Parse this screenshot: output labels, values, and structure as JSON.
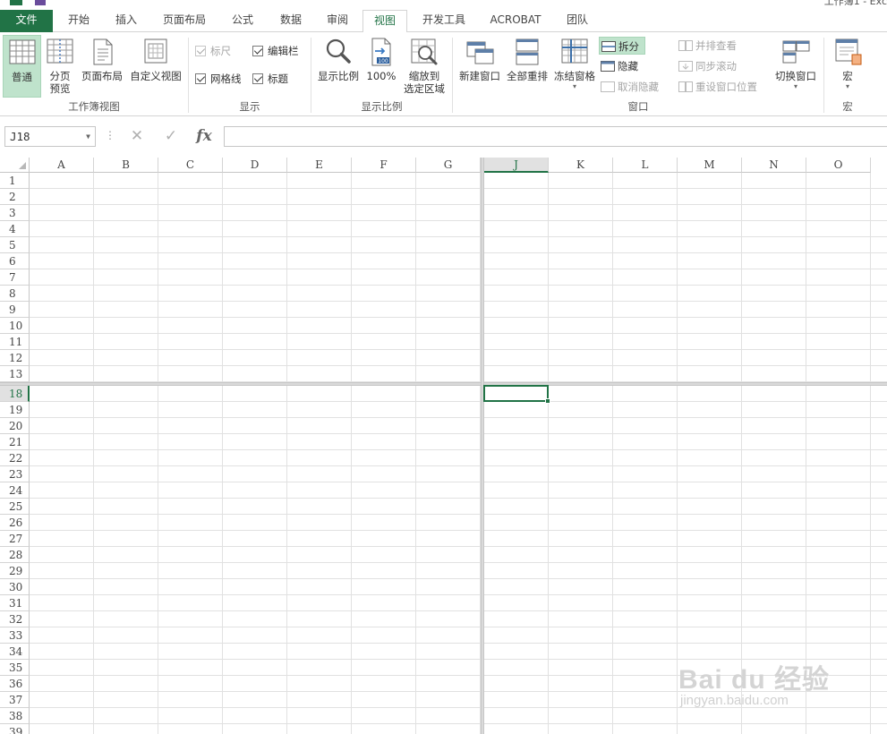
{
  "window": {
    "title_fragment": "工作簿1 - Exc"
  },
  "tabs": [
    {
      "label": "文件",
      "active": false,
      "file": true
    },
    {
      "label": "开始"
    },
    {
      "label": "插入"
    },
    {
      "label": "页面布局"
    },
    {
      "label": "公式"
    },
    {
      "label": "数据"
    },
    {
      "label": "审阅"
    },
    {
      "label": "视图",
      "active": true
    },
    {
      "label": "开发工具"
    },
    {
      "label": "ACROBAT"
    },
    {
      "label": "团队"
    }
  ],
  "ribbon": {
    "workbook_views": {
      "label": "工作簿视图",
      "normal": "普通",
      "page_break_1": "分页",
      "page_break_2": "预览",
      "page_layout": "页面布局",
      "custom_views": "自定义视图"
    },
    "show": {
      "label": "显示",
      "ruler": "标尺",
      "formula_bar": "编辑栏",
      "gridlines": "网格线",
      "headings": "标题"
    },
    "zoom": {
      "label": "显示比例",
      "zoom": "显示比例",
      "zoom_100": "100%",
      "zoom_to_selection_1": "缩放到",
      "zoom_to_selection_2": "选定区域",
      "icon_badge": "100"
    },
    "window": {
      "label": "窗口",
      "new_window": "新建窗口",
      "arrange_all": "全部重排",
      "freeze_panes": "冻结窗格",
      "split": "拆分",
      "hide": "隐藏",
      "unhide": "取消隐藏",
      "view_side_by_side": "并排查看",
      "sync_scroll": "同步滚动",
      "reset_position": "重设窗口位置",
      "switch_windows": "切换窗口"
    },
    "macros": {
      "label": "宏",
      "macros": "宏"
    }
  },
  "formula_bar": {
    "name_box": "J18",
    "formula": ""
  },
  "grid": {
    "columns_left": [
      "A",
      "B",
      "C",
      "D",
      "E",
      "F",
      "G"
    ],
    "columns_right": [
      "J",
      "K",
      "L",
      "M",
      "N",
      "O"
    ],
    "rows_top": [
      "1",
      "2",
      "3",
      "4",
      "5",
      "6",
      "7",
      "8",
      "9",
      "10",
      "11",
      "12",
      "13"
    ],
    "rows_bottom": [
      "18",
      "19",
      "20",
      "21",
      "22",
      "23",
      "24",
      "25",
      "26",
      "27",
      "28",
      "29",
      "30",
      "31",
      "32",
      "33",
      "34",
      "35",
      "36",
      "37",
      "38",
      "39"
    ],
    "active_cell": "J18"
  },
  "watermark": {
    "main": "Bai du 经验",
    "sub": "jingyan.baidu.com"
  },
  "colors": {
    "accent": "#217346",
    "selected_bg": "#bfe3cc"
  }
}
